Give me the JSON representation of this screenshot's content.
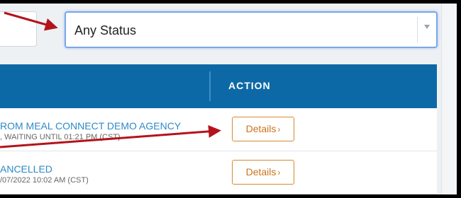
{
  "filter": {
    "status_value": "Any Status"
  },
  "table": {
    "headers": {
      "action": "ACTION"
    },
    "rows": [
      {
        "title": "ROM MEAL CONNECT DEMO AGENCY",
        "sub": ", WAITING UNTIL 01:21 PM (CST)",
        "action_label": "Details",
        "action_icon": "chevron-right-icon"
      },
      {
        "title": "ANCELLED",
        "sub": "/07/2022 10:02 AM (CST)",
        "action_label": "Details",
        "action_icon": "chevron-right-icon"
      }
    ]
  },
  "colors": {
    "header_bg": "#0d69a6",
    "link": "#2f89c8",
    "button_accent": "#d58a2f",
    "annotation_arrow": "#b3141c"
  }
}
